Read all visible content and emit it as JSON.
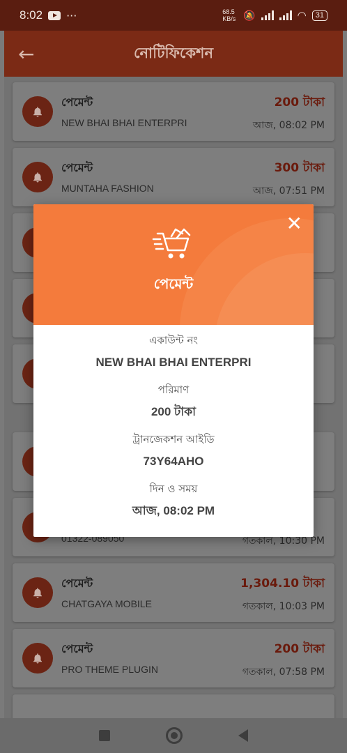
{
  "status_bar": {
    "time": "8:02",
    "more": "···",
    "speed": "68.5 KB/s",
    "battery": "31"
  },
  "app_bar": {
    "back_icon": "arrow-left-icon",
    "title": "নোটিফিকেশন"
  },
  "notifications": [
    {
      "type": "পেমেন্ট",
      "name": "NEW BHAI BHAI ENTERPRI",
      "amount": "200 টাকা",
      "time": "আজ, 08:02 PM"
    },
    {
      "type": "পেমেন্ট",
      "name": "MUNTAHA FASHION",
      "amount": "300 টাকা",
      "time": "আজ, 07:51 PM"
    },
    {
      "type": "",
      "name": "",
      "amount": "",
      "time": ""
    },
    {
      "type": "",
      "name": "",
      "amount": "",
      "time": ""
    },
    {
      "type": "",
      "name": "",
      "amount": "",
      "time": ""
    },
    {
      "type": "",
      "name": "",
      "amount": "",
      "time": ""
    },
    {
      "type": "",
      "name": "01322-089050",
      "amount": "",
      "time": "গতকাল, 10:30 PM"
    },
    {
      "type": "পেমেন্ট",
      "name": "CHATGAYA MOBILE",
      "amount": "1,304.10 টাকা",
      "time": "গতকাল, 10:03 PM"
    },
    {
      "type": "পেমেন্ট",
      "name": "PRO THEME PLUGIN",
      "amount": "200 টাকা",
      "time": "গতকাল, 07:58 PM"
    }
  ],
  "modal": {
    "title": "পেমেন্ট",
    "close_icon": "close-icon",
    "header_icon": "shopping-cart-icon",
    "account_label": "একাউন্ট নং",
    "account_value": "NEW BHAI BHAI ENTERPRI",
    "amount_label": "পরিমাণ",
    "amount_value": "200 টাকা",
    "txn_label": "ট্রানজেকশন আইডি",
    "txn_value": "73Y64AHO",
    "datetime_label": "দিন ও সময়",
    "datetime_value": "আজ, 08:02 PM"
  },
  "colors": {
    "accent": "#f47b3c",
    "app_bar": "#7b2a15",
    "amount": "#6a1a0c",
    "bell_bg": "#6b2414"
  }
}
